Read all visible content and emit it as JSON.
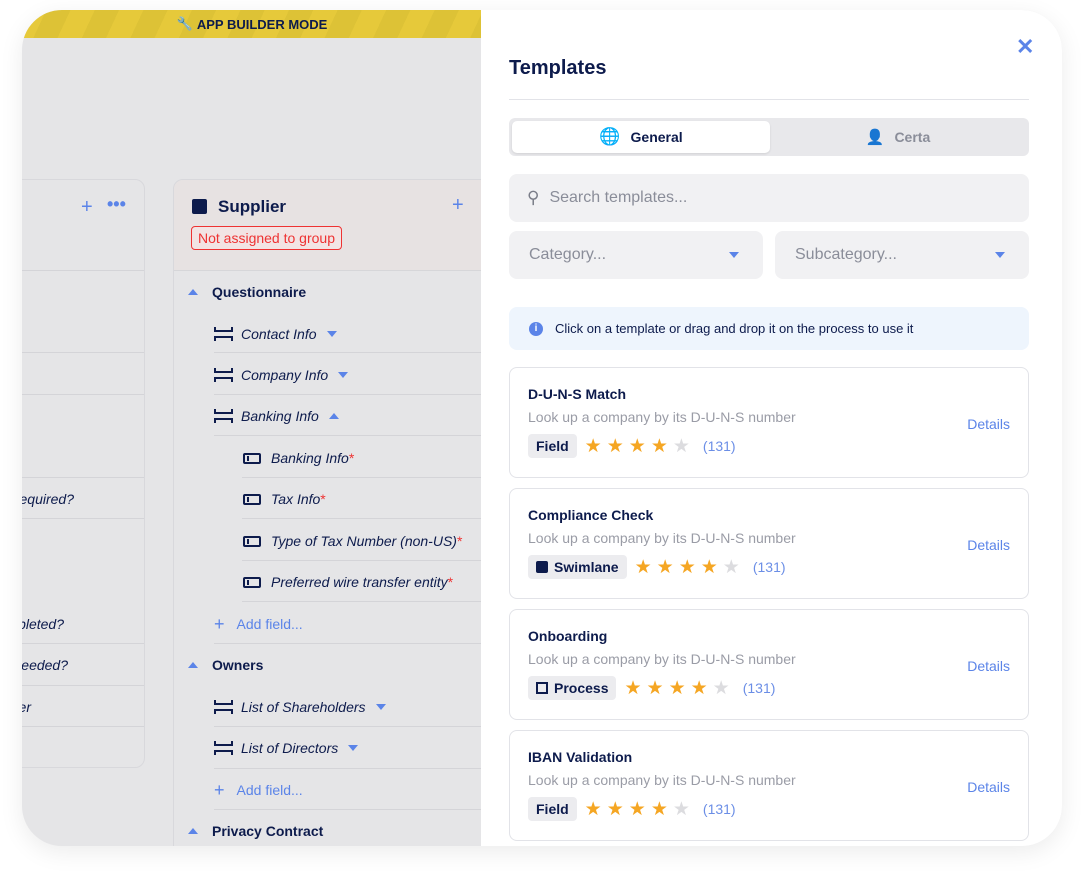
{
  "banner": {
    "label": "APP BUILDER MODE",
    "icon": "wrench-icon"
  },
  "left_column": {
    "rows": [
      "equired?",
      "pleted?",
      "eeded?",
      "er"
    ]
  },
  "supplier": {
    "title": "Supplier",
    "badge": "Not assigned to group",
    "sections": [
      {
        "label": "Questionnaire",
        "items": [
          {
            "label": "Contact Info"
          },
          {
            "label": "Company Info"
          },
          {
            "label": "Banking Info"
          }
        ],
        "subfields": [
          "Banking Info",
          "Tax Info",
          "Type of Tax Number (non-US)",
          "Preferred wire transfer entity"
        ],
        "add": "Add field..."
      },
      {
        "label": "Owners",
        "items": [
          {
            "label": "List of Shareholders"
          },
          {
            "label": "List of Directors"
          }
        ],
        "add": "Add field..."
      },
      {
        "label": "Privacy Contract"
      }
    ],
    "required_mark": "*"
  },
  "panel": {
    "title": "Templates",
    "tabs": [
      {
        "label": "General",
        "icon": "globe-icon",
        "active": true
      },
      {
        "label": "Certa",
        "icon": "user-icon",
        "active": false
      }
    ],
    "search_placeholder": "Search templates...",
    "category_placeholder": "Category...",
    "subcategory_placeholder": "Subcategory...",
    "info": "Click on a template or drag and drop it on the process to use it",
    "cards": [
      {
        "title": "D-U-N-S Match",
        "desc": "Look up a company by its D-U-N-S number",
        "type": "Field",
        "rating": 4,
        "count": "(131)",
        "details": "Details"
      },
      {
        "title": "Compliance Check",
        "desc": "Look up a company by its D-U-N-S number",
        "type": "Swimlane",
        "rating": 4,
        "count": "(131)",
        "details": "Details"
      },
      {
        "title": "Onboarding",
        "desc": "Look up a company by its D-U-N-S number",
        "type": "Process",
        "rating": 4,
        "count": "(131)",
        "details": "Details"
      },
      {
        "title": "IBAN Validation",
        "desc": "Look up a company by its D-U-N-S number",
        "type": "Field",
        "rating": 4,
        "count": "(131)",
        "details": "Details"
      }
    ]
  },
  "colors": {
    "accent": "#5b84e8",
    "banner": "#e6c93a",
    "star": "#f5a623",
    "error": "#e33333",
    "text": "#0d1b4c"
  }
}
